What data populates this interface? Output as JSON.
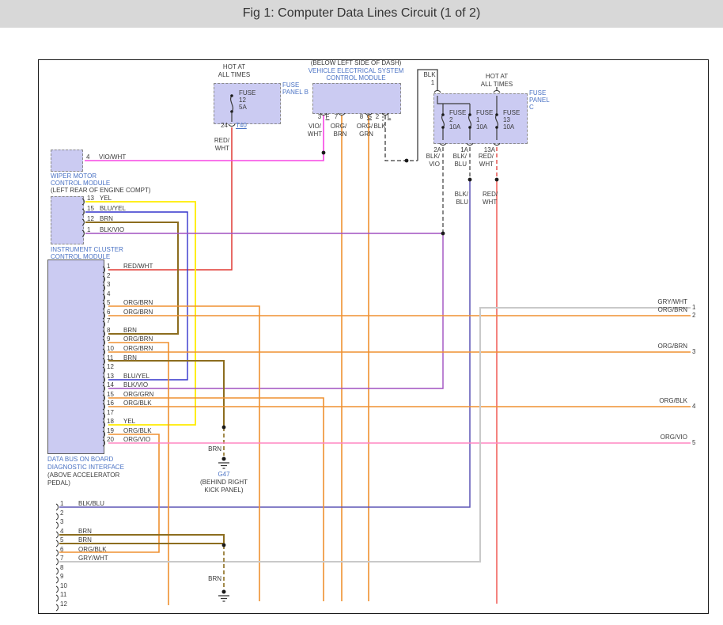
{
  "title": "Fig 1: Computer Data Lines Circuit (1 of 2)",
  "colors": {
    "red_wht": "#e03a34",
    "vio_wht": "#f746e4",
    "yel": "#ffec00",
    "blu_yel": "#3333cc",
    "brn": "#8c6d1f",
    "blk_vio": "#a050c0",
    "org": "#ef9130",
    "org_vio": "#ff85c2",
    "blk_blu": "#5d55b5",
    "gry_wht": "#c9c9c9",
    "blk": "#3c3c3c",
    "module_fill": "#cbcbf2",
    "label_blue": "#4a72c4",
    "title_bg": "#d8d8d8"
  },
  "fuse_panel_b": {
    "hot1": "HOT AT",
    "hot2": "ALL TIMES",
    "panel1": "FUSE",
    "panel2": "PANEL B",
    "fuse_word": "FUSE",
    "fuse_num": "12",
    "fuse_amp": "5A",
    "pin": "24",
    "connector": "T40",
    "wire1": "RED/",
    "wire2": "WHT"
  },
  "vecm": {
    "loc": "(BELOW LEFT SIDE OF DASH)",
    "name1": "VEHICLE ELECTRICAL SYSTEM",
    "name2": "CONTROL MODULE",
    "pin_letters": [
      {
        "t": "3",
        "u": false
      },
      {
        "t": "F",
        "u": true
      },
      {
        "t": "7",
        "u": false
      },
      {
        "t": "8",
        "u": false
      },
      {
        "t": "G",
        "u": true
      },
      {
        "t": "2",
        "u": false
      },
      {
        "t": "L",
        "u": true
      }
    ],
    "w1a": "VIO/",
    "w1b": "WHT",
    "w2a": "ORG/",
    "w2b": "BRN",
    "w3a": "ORG/",
    "w3b": "GRN",
    "w4": "BLK"
  },
  "fuse_panel_c": {
    "blk": "BLK",
    "pin1": "1",
    "hot1": "HOT AT",
    "hot2": "ALL TIMES",
    "panel1": "FUSE",
    "panel2": "PANEL",
    "panel3": "C",
    "fuses": [
      {
        "w": "FUSE",
        "n": "2",
        "a": "10A",
        "pin": "2A"
      },
      {
        "w": "FUSE",
        "n": "1",
        "a": "10A",
        "pin": "1A"
      },
      {
        "w": "FUSE",
        "n": "13",
        "a": "10A",
        "pin": "13A"
      }
    ],
    "dropA1": "BLK/",
    "dropA2": "VIO",
    "dropB1": "BLK/",
    "dropB2": "BLU",
    "dropC1": "RED/",
    "dropC2": "WHT",
    "dropB1b": "BLK/",
    "dropB2b": "BLU",
    "dropC1b": "RED/",
    "dropC2b": "WHT"
  },
  "wiper": {
    "name1": "WIPER MOTOR",
    "name2": "CONTROL MODULE",
    "loc": "(LEFT REAR OF ENGINE COMPT)",
    "pin": "4",
    "wire": "VIO/WHT"
  },
  "cluster": {
    "name1": "INSTRUMENT CLUSTER",
    "name2": "CONTROL MODULE",
    "pins": [
      {
        "n": "13",
        "w": "YEL"
      },
      {
        "n": "15",
        "w": "BLU/YEL"
      },
      {
        "n": "12",
        "w": "BRN"
      },
      {
        "n": "1",
        "w": "BLK/VIO"
      }
    ]
  },
  "databus": {
    "name1": "DATA BUS ON BOARD",
    "name2": "DIAGNOSTIC INTERFACE",
    "loc1": "(ABOVE ACCELERATOR",
    "loc2": "PEDAL)",
    "pin_labels": [
      "RED/WHT",
      "",
      "",
      "",
      "ORG/BRN",
      "ORG/BRN",
      "",
      "BRN",
      "ORG/BRN",
      "ORG/BRN",
      "BRN",
      "",
      "BLU/YEL",
      "BLK/VIO",
      "ORG/GRN",
      "ORG/BLK",
      "",
      "YEL",
      "ORG/BLK",
      "ORG/VIO"
    ]
  },
  "bottom_connector": {
    "pin_labels": [
      "BLK/BLU",
      "",
      "",
      "BRN",
      "BRN",
      "ORG/BLK",
      "GRY/WHT",
      "",
      "",
      "",
      "",
      ""
    ]
  },
  "ground_g47": {
    "wire": "BRN",
    "name": "G47",
    "loc1": "(BEHIND RIGHT",
    "loc2": "KICK PANEL)"
  },
  "ground_bottom": {
    "wire": "BRN"
  },
  "right_exits": [
    {
      "w": "GRY/WHT",
      "n": "1"
    },
    {
      "w": "ORG/BRN",
      "n": "2"
    },
    {
      "w": "ORG/BRN",
      "n": "3"
    },
    {
      "w": "ORG/BLK",
      "n": "4"
    },
    {
      "w": "ORG/VIO",
      "n": "5"
    }
  ]
}
